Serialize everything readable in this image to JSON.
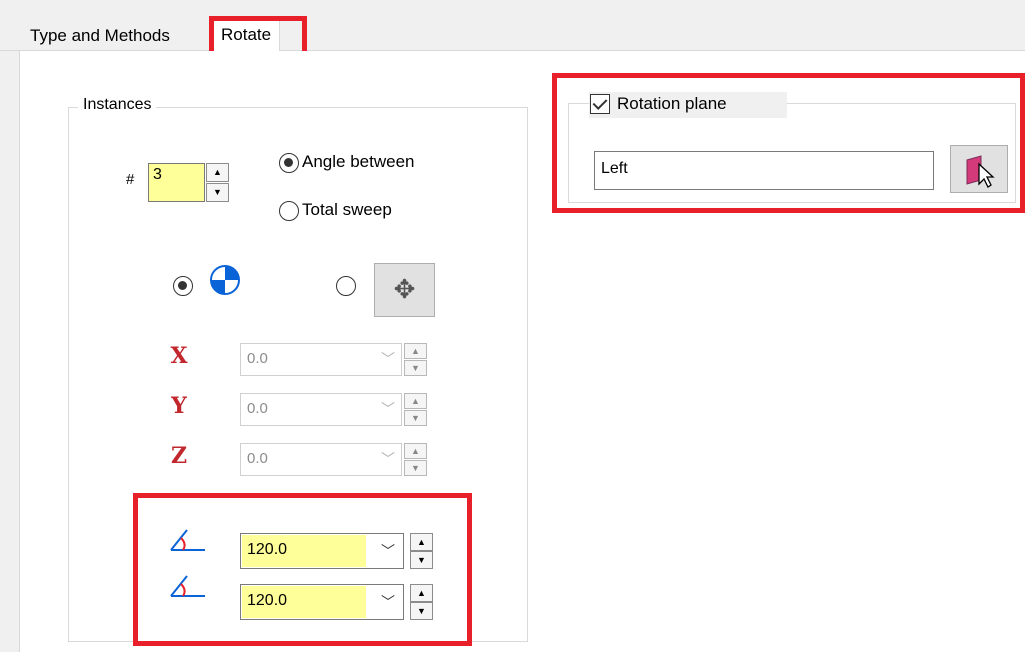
{
  "tabs": [
    {
      "label": "Type and Methods",
      "active": false
    },
    {
      "label": "Rotate",
      "active": true
    }
  ],
  "instances": {
    "group_label": "Instances",
    "count_label": "#",
    "count_value": "3",
    "mode_options": [
      {
        "label": "Angle between",
        "selected": true
      },
      {
        "label": "Total sweep",
        "selected": false
      }
    ],
    "center_options": [
      {
        "icon": "coordinate-origin-icon",
        "selected": true
      },
      {
        "icon": "move-triad-icon",
        "selected": false
      }
    ],
    "axes": [
      {
        "label": "X",
        "value": "0.0",
        "enabled": false
      },
      {
        "label": "Y",
        "value": "0.0",
        "enabled": false
      },
      {
        "label": "Z",
        "value": "0.0",
        "enabled": false
      }
    ],
    "angles": [
      {
        "icon": "angle-icon",
        "value": "120.0"
      },
      {
        "icon": "angle-icon",
        "value": "120.0"
      }
    ]
  },
  "rotation_plane": {
    "label": "Rotation plane",
    "checked": true,
    "value": "Left"
  },
  "colors": {
    "highlight": "#e8202a",
    "field_yellow": "#ffff99",
    "axis_red": "#c1272d",
    "origin_blue": "#0a64d8"
  }
}
